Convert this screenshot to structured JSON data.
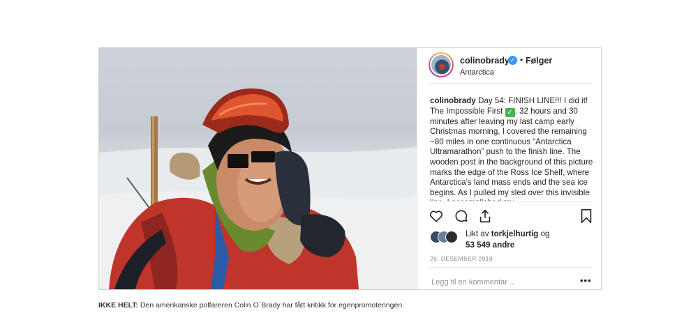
{
  "post": {
    "username": "colinobrady",
    "verified_icon": "verified-badge-icon",
    "separator": "•",
    "follow_label": "Følger",
    "location": "Antarctica",
    "caption_user": "colinobrady",
    "caption_part1": " Day 54: FINISH LINE!!! I did it! The Impossible First ",
    "caption_check": "✓",
    "caption_part2": ". 32 hours and 30 minutes after leaving my last camp early Christmas morning, I covered the remaining ~80 miles in one continuous “Antarctica Ultramarathon” push to the finish line. The wooden post in the background of this picture marks the edge of the Ross Ice Shelf, where Antarctica’s land mass ends and the sea ice begins. As I pulled my sled over this invisible line, I accomplished my",
    "likes_prefix": "Likt av ",
    "likes_user": "torkjelhurtig",
    "likes_mid": " og",
    "likes_count": "53 549 andre",
    "date": "26. DESEMBER 2018",
    "comment_placeholder": "Legg til en kommentar ...",
    "more_label": "•••"
  },
  "figcaption": {
    "label": "IKKE HELT:",
    "text": " Den amerikanske polfareren Colin O´Brady har fått kritikk for egenpromoteringen."
  },
  "colors": {
    "verified": "#3897f0",
    "text": "#262626",
    "muted": "#8e8e8e",
    "jacket": "#c0352b",
    "goggles": "#e0542f"
  }
}
